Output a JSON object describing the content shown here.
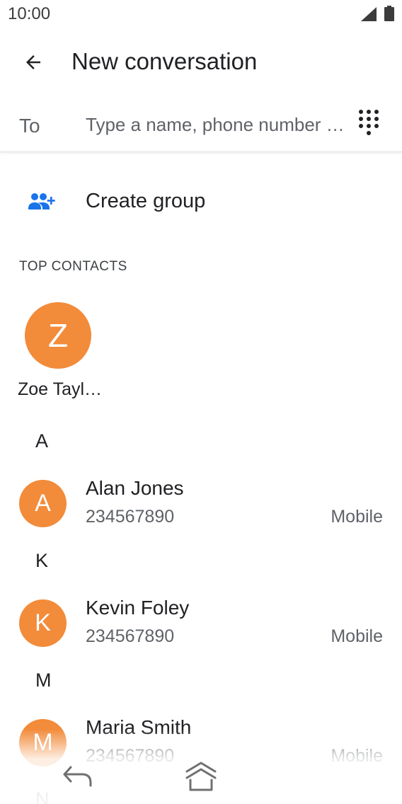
{
  "status_bar": {
    "time": "10:00"
  },
  "app_bar": {
    "title": "New conversation",
    "back_icon": "arrow-back-icon"
  },
  "to_field": {
    "label": "To",
    "placeholder": "Type a name, phone number …",
    "value": "",
    "dialpad_icon": "dialpad-icon"
  },
  "create_group": {
    "label": "Create group",
    "icon": "group-add-icon",
    "accent_color": "#1a73e8"
  },
  "top_contacts": {
    "header": "TOP CONTACTS",
    "items": [
      {
        "initial": "Z",
        "name": "Zoe Tayl…"
      }
    ]
  },
  "contacts": [
    {
      "letter": "A",
      "initial": "A",
      "name": "Alan Jones",
      "number": "234567890",
      "type": "Mobile"
    },
    {
      "letter": "K",
      "initial": "K",
      "name": "Kevin Foley",
      "number": "234567890",
      "type": "Mobile"
    },
    {
      "letter": "M",
      "initial": "M",
      "name": "Maria Smith",
      "number": "234567890",
      "type": "Mobile"
    }
  ],
  "partial_letter": "N",
  "colors": {
    "avatar": "#f28b3a",
    "text_primary": "#202124",
    "text_secondary": "#5f6368"
  },
  "nav_bar": {
    "back_icon": "nav-back-icon",
    "home_icon": "nav-home-icon"
  }
}
